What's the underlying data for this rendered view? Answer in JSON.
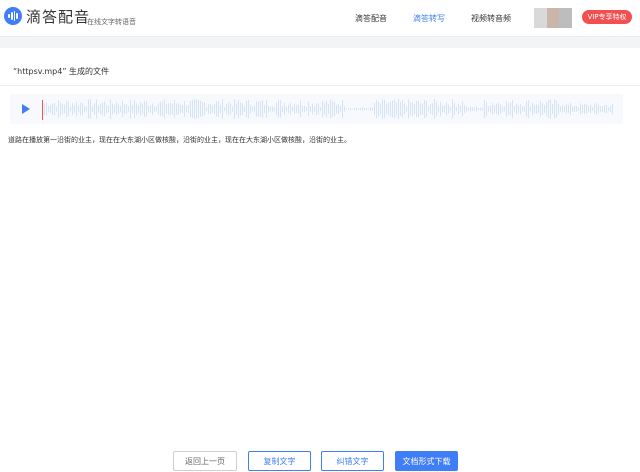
{
  "header": {
    "brand": "滴答配音",
    "subbrand": "在线文字转语音",
    "nav": [
      "滴答配音",
      "滴答转写",
      "视频转音频"
    ],
    "active_nav": "滴答转写",
    "vip_label": "VIP专享特权",
    "avatar_colors": [
      "#d9d9d9",
      "#c9b6a8",
      "#bdbdbd"
    ]
  },
  "file": {
    "title": "“httpsv.mp4” 生成的文件"
  },
  "player": {
    "icon": "play-icon",
    "progress": 0.0
  },
  "transcript": "道路在播放第一沿街的业主，现在在大东湖小区做核酸，沿街的业主，现在在大东湖小区做核酸，沿街的业主。",
  "buttons": {
    "back": "返回上一页",
    "copy": "复制文字",
    "correct": "纠错文字",
    "download": "文档形式下载"
  },
  "colors": {
    "accent": "#3f7ef6",
    "vip": "#f25050",
    "wave": "#d4e3f7"
  }
}
